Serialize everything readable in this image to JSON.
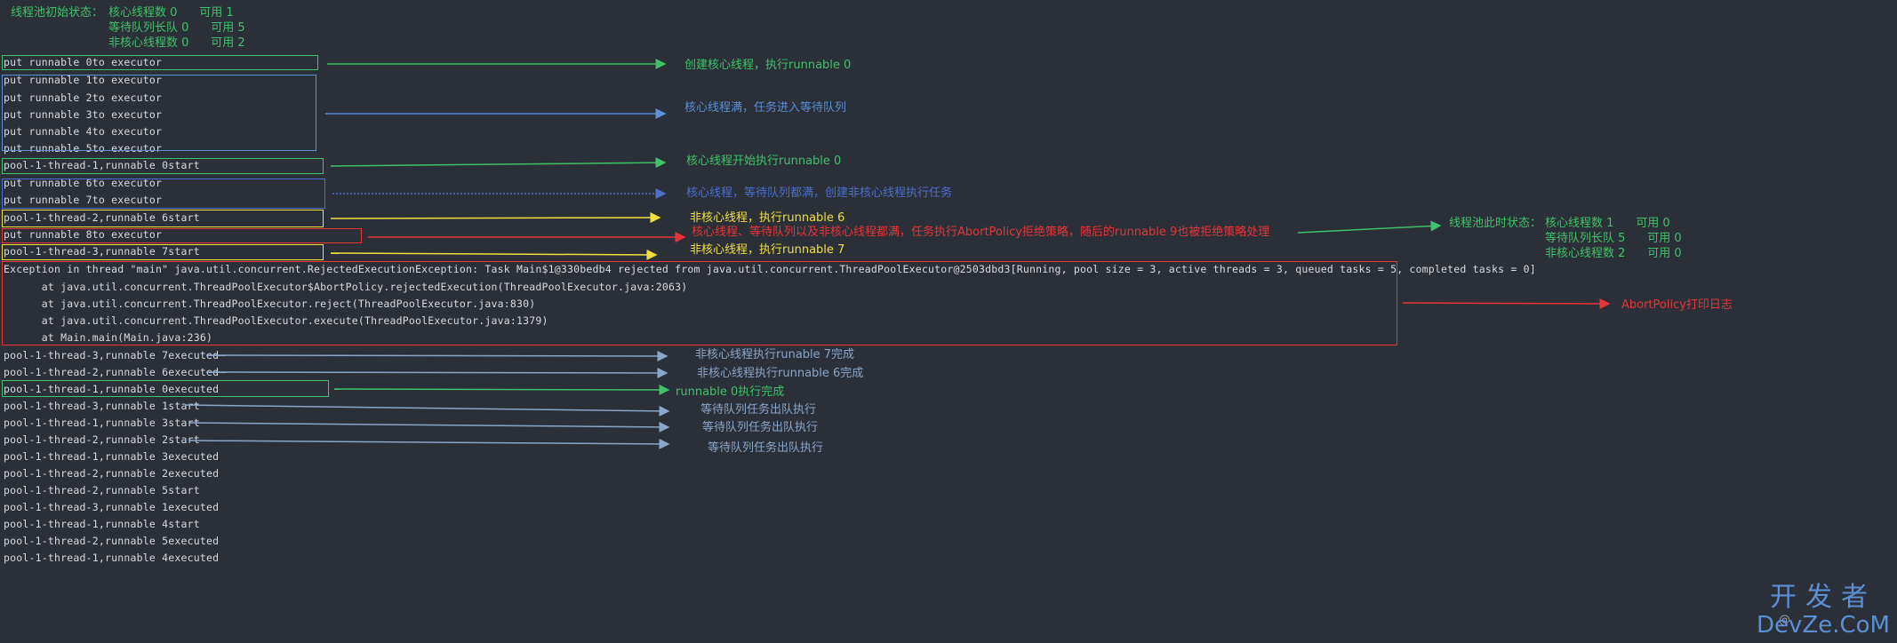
{
  "initial_state": {
    "label": "线程池初始状态：",
    "lines": [
      "核心线程数 0      可用 1",
      "等待队列长队 0      可用 5",
      "非核心线程数 0      可用 2"
    ]
  },
  "current_state": {
    "label": "线程池此时状态：",
    "lines": [
      "核心线程数 1      可用 0",
      "等待队列长队 5      可用 0",
      "非核心线程数 2      可用 0"
    ]
  },
  "log_lines": [
    "put runnable 0to executor",
    "put runnable 1to executor",
    "put runnable 2to executor",
    "put runnable 3to executor",
    "put runnable 4to executor",
    "put runnable 5to executor",
    "pool-1-thread-1,runnable 0start",
    "put runnable 6to executor",
    "put runnable 7to executor",
    "pool-1-thread-2,runnable 6start",
    "put runnable 8to executor",
    "pool-1-thread-3,runnable 7start",
    "Exception in thread \"main\" java.util.concurrent.RejectedExecutionException: Task Main$1@330bedb4 rejected from java.util.concurrent.ThreadPoolExecutor@2503dbd3[Running, pool size = 3, active threads = 3, queued tasks = 5, completed tasks = 0]",
    "      at java.util.concurrent.ThreadPoolExecutor$AbortPolicy.rejectedExecution(ThreadPoolExecutor.java:2063)",
    "      at java.util.concurrent.ThreadPoolExecutor.reject(ThreadPoolExecutor.java:830)",
    "      at java.util.concurrent.ThreadPoolExecutor.execute(ThreadPoolExecutor.java:1379)",
    "      at Main.main(Main.java:236)",
    "pool-1-thread-3,runnable 7executed",
    "pool-1-thread-2,runnable 6executed",
    "pool-1-thread-1,runnable 0executed",
    "pool-1-thread-3,runnable 1start",
    "pool-1-thread-1,runnable 3start",
    "pool-1-thread-2,runnable 2start",
    "pool-1-thread-1,runnable 3executed",
    "pool-1-thread-2,runnable 2executed",
    "pool-1-thread-2,runnable 5start",
    "pool-1-thread-3,runnable 1executed",
    "pool-1-thread-1,runnable 4start",
    "pool-1-thread-2,runnable 5executed",
    "pool-1-thread-1,runnable 4executed"
  ],
  "notes": [
    {
      "text": "创建核心线程，执行runnable 0",
      "color": "#3fc26a"
    },
    {
      "text": "核心线程满，任务进入等待队列",
      "color": "#5b8fd6"
    },
    {
      "text": "核心线程开始执行runnable 0",
      "color": "#3fc26a"
    },
    {
      "text": "核心线程，等待队列都满，创建非核心线程执行任务",
      "color": "#4c6fd0"
    },
    {
      "text": "非核心线程，执行runnable 6",
      "color": "#f0e040"
    },
    {
      "text": "核心线程、等待队列以及非核心线程都满，任务执行AbortPolicy拒绝策略，随后的runnable 9也被拒绝策略处理",
      "color": "#e8353a"
    },
    {
      "text": "非核心线程，执行runnable 7",
      "color": "#f0e040"
    },
    {
      "text": "AbortPolicy打印日志",
      "color": "#e8353a"
    },
    {
      "text": "非核心线程执行runable 7完成",
      "color": "#8aa6c8"
    },
    {
      "text": "非核心线程执行runnable 6完成",
      "color": "#8aa6c8"
    },
    {
      "text": "runnable 0执行完成",
      "color": "#3fc26a"
    },
    {
      "text": "等待队列任务出队执行",
      "color": "#8aa6c8"
    },
    {
      "text": "等待队列任务出队执行",
      "color": "#8aa6c8"
    },
    {
      "text": "等待队列任务出队执行",
      "color": "#8aa6c8"
    }
  ],
  "colors": {
    "green": "#3fc26a",
    "blue": "#5b8fd6",
    "yellow": "#f0e040",
    "red": "#e8353a"
  },
  "watermark": {
    "cn": "开发者",
    "en": "DevZe.CoM",
    "at": "@"
  }
}
